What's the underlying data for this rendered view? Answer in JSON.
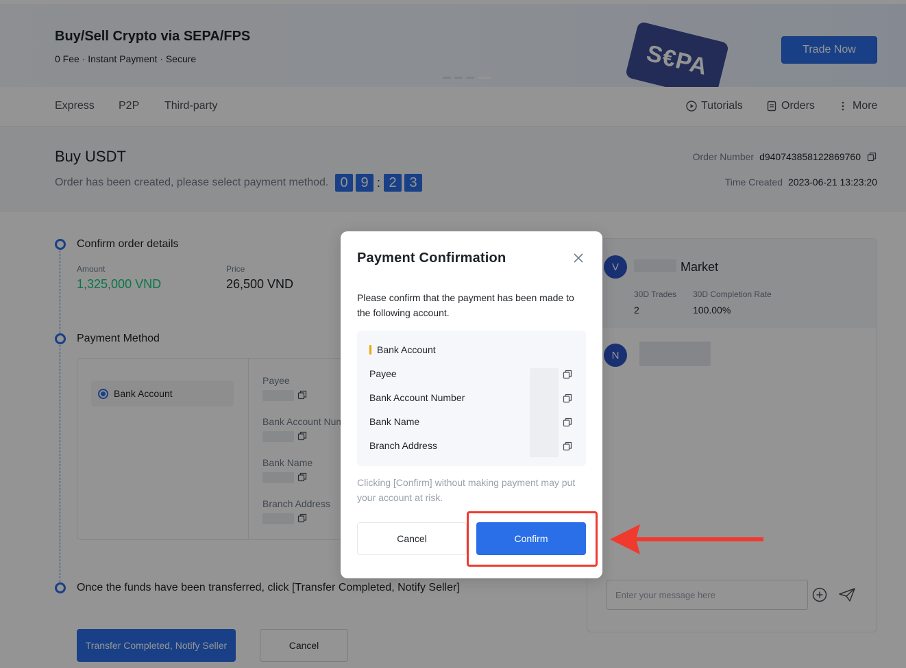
{
  "banner": {
    "title": "Buy/Sell Crypto via SEPA/FPS",
    "subtitle": "0 Fee · Instant Payment · Secure",
    "card_text": "S€PA",
    "cta_label": "Trade Now"
  },
  "nav": {
    "tabs": [
      {
        "label": "Express"
      },
      {
        "label": "P2P"
      },
      {
        "label": "Third-party"
      }
    ],
    "tutorials_label": "Tutorials",
    "orders_label": "Orders",
    "more_label": "More"
  },
  "order": {
    "title": "Buy USDT",
    "status_text": "Order has been created, please select payment method.",
    "timer_digits": [
      "0",
      "9",
      "2",
      "3"
    ],
    "timer_separator": ":",
    "order_number_label": "Order Number",
    "order_number": "d940743858122869760",
    "time_created_label": "Time Created",
    "time_created": "2023-06-21 13:23:20"
  },
  "steps": {
    "step1_title": "Confirm order details",
    "amount_label": "Amount",
    "amount_value": "1,325,000 VND",
    "price_label": "Price",
    "price_value": "26,500 VND",
    "step2_title": "Payment Method",
    "method_option": "Bank Account",
    "payee_label": "Payee",
    "bank_account_number_label": "Bank Account Num",
    "bank_name_label": "Bank Name",
    "branch_address_label": "Branch Address",
    "step3_title": "Once the funds have been transferred, click [Transfer Completed, Notify Seller]",
    "transfer_button": "Transfer Completed, Notify Seller",
    "cancel_button": "Cancel"
  },
  "chat": {
    "avatar_v": "V",
    "market_label": "Market",
    "trades_label": "30D Trades",
    "trades_value": "2",
    "completion_label": "30D Completion Rate",
    "completion_value": "100.00%",
    "avatar_n": "N",
    "input_placeholder": "Enter your message here"
  },
  "modal": {
    "title": "Payment Confirmation",
    "description": "Please confirm that the payment has been made to the following account.",
    "account_header": "Bank Account",
    "rows": [
      {
        "label": "Payee"
      },
      {
        "label": "Bank Account Number"
      },
      {
        "label": "Bank Name"
      },
      {
        "label": "Branch Address"
      }
    ],
    "warning": "Clicking [Confirm] without making payment may put your account at risk.",
    "cancel_label": "Cancel",
    "confirm_label": "Confirm"
  },
  "colors": {
    "accent": "#2b6fe8",
    "annotation_red": "#f03a2e",
    "amount_green": "#0ecb81",
    "account_marker": "#f0a500"
  }
}
